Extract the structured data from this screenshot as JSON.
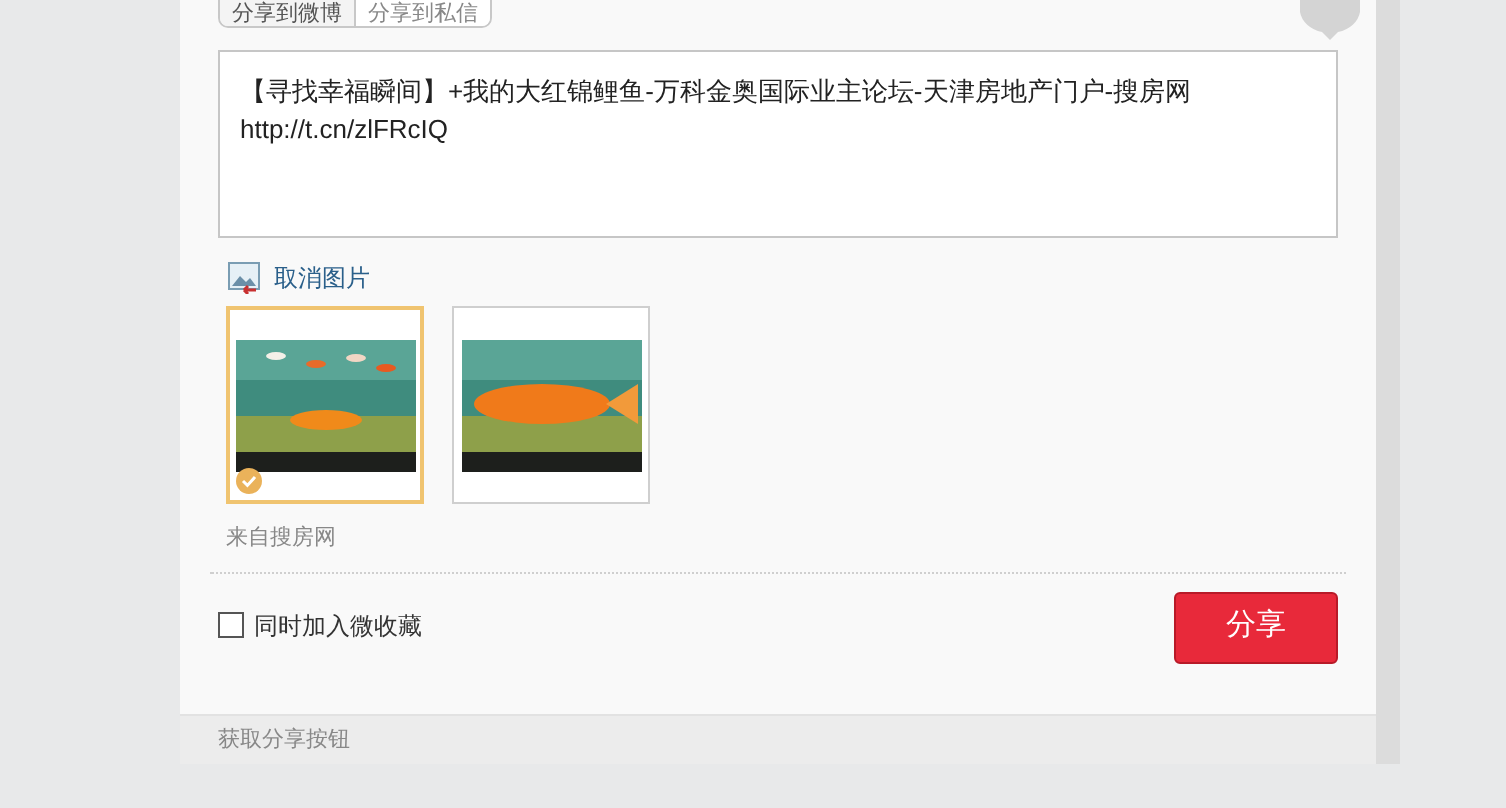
{
  "tabs": [
    {
      "label": "分享到微博",
      "selected": true
    },
    {
      "label": "分享到私信",
      "selected": false
    }
  ],
  "message": {
    "value": "【寻找幸福瞬间】+我的大红锦鲤鱼-万科金奥国际业主论坛-天津房地产门户-搜房网\nhttp://t.cn/zlFRcIQ"
  },
  "cancel_image_link": "取消图片",
  "images": [
    {
      "kind": "picture",
      "selected": true
    },
    {
      "kind": "picture",
      "selected": false
    }
  ],
  "source": "来自搜房网",
  "favorite_checkbox": {
    "label": "同时加入微收藏",
    "checked": false
  },
  "share_button": "分享",
  "footer_link": "获取分享按钮"
}
